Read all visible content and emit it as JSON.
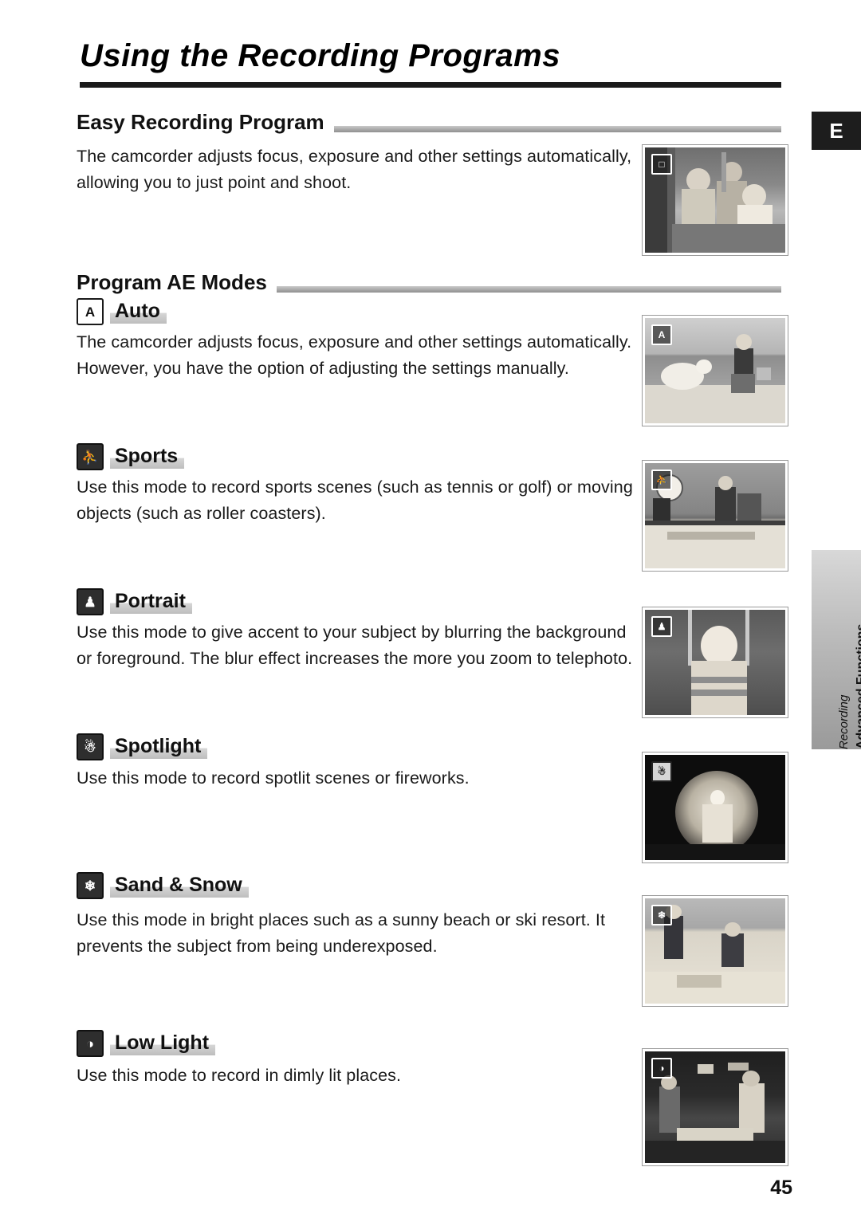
{
  "page": {
    "title": "Using the Recording Programs",
    "lang_tab": "E",
    "page_number": "45",
    "side_tab_line1": "Advanced Functions -",
    "side_tab_line2": "Recording"
  },
  "sections": [
    {
      "heading": "Easy Recording Program",
      "body": "The camcorder adjusts focus, exposure and other settings automatically, allowing you to just point and shoot."
    },
    {
      "heading": "Program AE Modes"
    }
  ],
  "modes": [
    {
      "icon": "auto-icon",
      "icon_glyph": "A",
      "label": "Auto",
      "body": "The camcorder adjusts focus, exposure and other settings automatically. However, you have the option of adjusting the settings manually."
    },
    {
      "icon": "sports-icon",
      "icon_glyph": "⛹",
      "label": "Sports",
      "body": "Use this mode to record sports scenes (such as tennis or golf) or moving objects (such as roller coasters)."
    },
    {
      "icon": "portrait-icon",
      "icon_glyph": "♟",
      "label": "Portrait",
      "body": "Use this mode to give accent to your subject by blurring the background or foreground. The blur effect increases the more you zoom to telephoto."
    },
    {
      "icon": "spotlight-icon",
      "icon_glyph": "☃",
      "label": "Spotlight",
      "body": "Use this mode to record spotlit scenes or fireworks."
    },
    {
      "icon": "sand-snow-icon",
      "icon_glyph": "❄",
      "label": "Sand & Snow",
      "body": "Use this mode in bright places such as a sunny beach or ski resort. It prevents the subject from being underexposed."
    },
    {
      "icon": "low-light-icon",
      "icon_glyph": "◑",
      "label": "Low Light",
      "body": "Use this mode to record in dimly lit places."
    }
  ],
  "photos": [
    {
      "name": "photo-easy-recording",
      "badge": "□"
    },
    {
      "name": "photo-auto",
      "badge": "A"
    },
    {
      "name": "photo-sports",
      "badge": "⛹"
    },
    {
      "name": "photo-portrait",
      "badge": "♟"
    },
    {
      "name": "photo-spotlight",
      "badge": "☃"
    },
    {
      "name": "photo-sand-snow",
      "badge": "❄"
    },
    {
      "name": "photo-low-light",
      "badge": "◑"
    }
  ]
}
